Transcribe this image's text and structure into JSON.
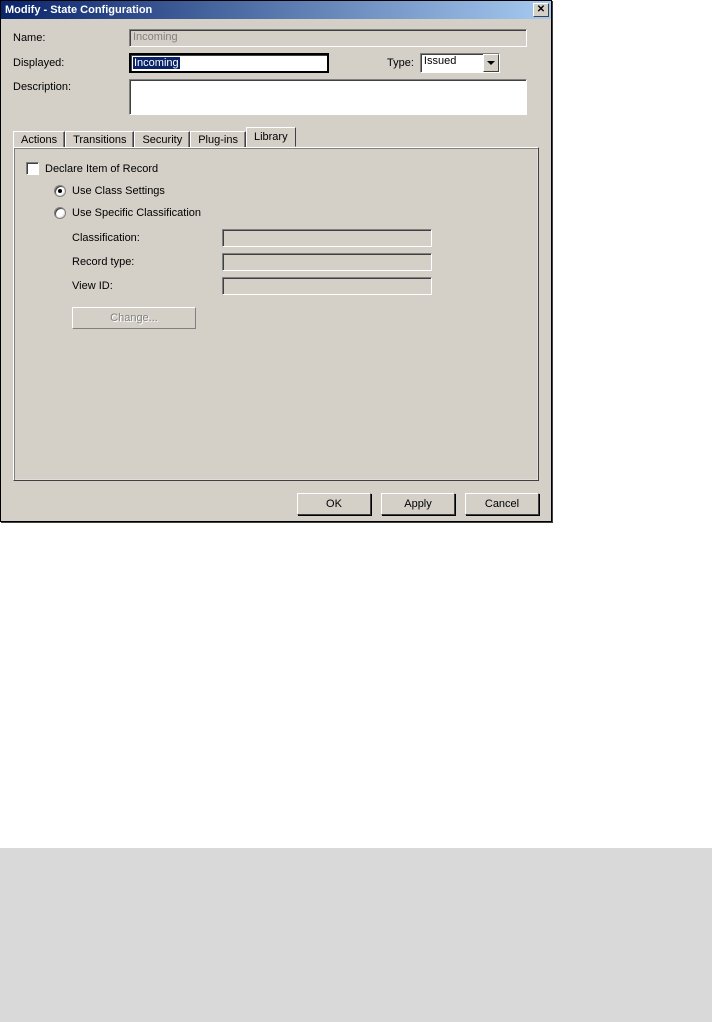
{
  "titlebar": {
    "title": "Modify - State Configuration"
  },
  "form": {
    "name_label": "Name:",
    "name_value": "Incoming",
    "displayed_label": "Displayed:",
    "displayed_value": "Incoming",
    "type_label": "Type:",
    "type_value": "Issued",
    "description_label": "Description:",
    "description_value": ""
  },
  "tabs": {
    "items": [
      {
        "label": "Actions"
      },
      {
        "label": "Transitions"
      },
      {
        "label": "Security"
      },
      {
        "label": "Plug-ins"
      },
      {
        "label": "Library"
      }
    ],
    "active": 4
  },
  "library": {
    "declare_label": "Declare Item of Record",
    "radio_class_label": "Use Class Settings",
    "radio_specific_label": "Use Specific Classification",
    "classification_label": "Classification:",
    "record_type_label": "Record type:",
    "view_id_label": "View ID:",
    "change_button": "Change..."
  },
  "buttons": {
    "ok": "OK",
    "apply": "Apply",
    "cancel": "Cancel"
  }
}
